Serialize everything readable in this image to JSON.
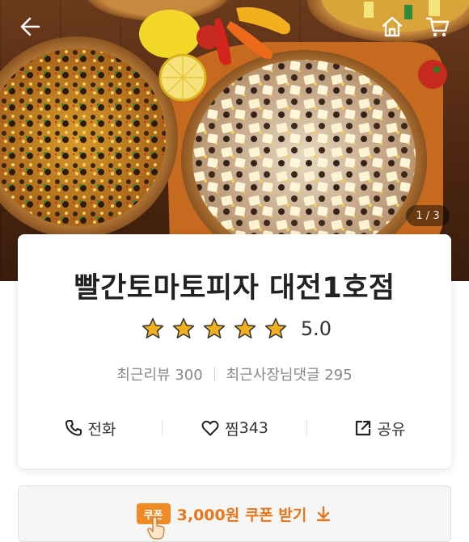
{
  "hero": {
    "page_indicator": "1 / 3",
    "icons": {
      "back": "back-arrow-icon",
      "home": "home-icon",
      "cart": "cart-icon"
    }
  },
  "store": {
    "name": "빨간토마토피자 대전1호점",
    "rating": {
      "stars": 5,
      "value": "5.0"
    },
    "stats": {
      "reviews": "최근리뷰 300",
      "owner_replies": "최근사장님댓글 295"
    }
  },
  "actions": {
    "call": "전화",
    "favorite_label": "찜",
    "favorite_count": "343",
    "share": "공유"
  },
  "coupon": {
    "badge": "쿠폰",
    "label": "3,000원 쿠폰 받기"
  },
  "colors": {
    "accent": "#e8761a",
    "star": "#f2b01e",
    "text": "#222222"
  }
}
